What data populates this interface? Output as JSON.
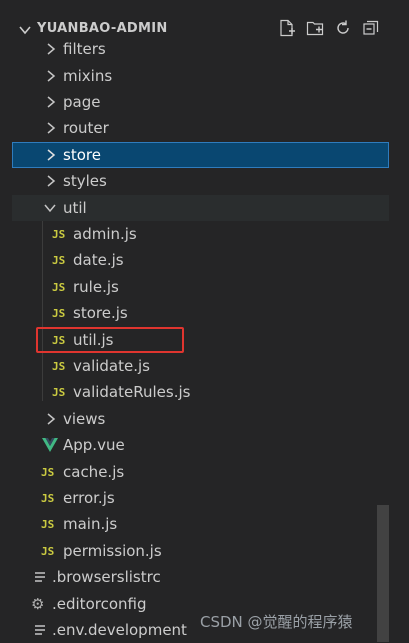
{
  "header": {
    "project_title": "YUANBAO-ADMIN"
  },
  "tree": [
    {
      "label": "filters",
      "type": "folder",
      "expanded": false,
      "icon": "chevron-right-icon"
    },
    {
      "label": "mixins",
      "type": "folder",
      "expanded": false,
      "icon": "chevron-right-icon"
    },
    {
      "label": "page",
      "type": "folder",
      "expanded": false,
      "icon": "chevron-right-icon"
    },
    {
      "label": "router",
      "type": "folder",
      "expanded": false,
      "icon": "chevron-right-icon"
    },
    {
      "label": "store",
      "type": "folder",
      "expanded": false,
      "selected": true,
      "icon": "chevron-right-icon"
    },
    {
      "label": "styles",
      "type": "folder",
      "expanded": false,
      "icon": "chevron-right-icon"
    },
    {
      "label": "util",
      "type": "folder",
      "expanded": true,
      "icon": "chevron-down-icon"
    },
    {
      "label": "admin.js",
      "type": "js",
      "icon_text": "JS"
    },
    {
      "label": "date.js",
      "type": "js",
      "icon_text": "JS"
    },
    {
      "label": "rule.js",
      "type": "js",
      "icon_text": "JS"
    },
    {
      "label": "store.js",
      "type": "js",
      "icon_text": "JS"
    },
    {
      "label": "util.js",
      "type": "js",
      "icon_text": "JS",
      "highlighted": true
    },
    {
      "label": "validate.js",
      "type": "js",
      "icon_text": "JS"
    },
    {
      "label": "validateRules.js",
      "type": "js",
      "icon_text": "JS"
    },
    {
      "label": "views",
      "type": "folder",
      "expanded": false,
      "icon": "chevron-right-icon"
    },
    {
      "label": "App.vue",
      "type": "vue",
      "icon": "vue-icon"
    },
    {
      "label": "cache.js",
      "type": "js",
      "icon_text": "JS"
    },
    {
      "label": "error.js",
      "type": "js",
      "icon_text": "JS"
    },
    {
      "label": "main.js",
      "type": "js",
      "icon_text": "JS"
    },
    {
      "label": "permission.js",
      "type": "js",
      "icon_text": "JS"
    },
    {
      "label": ".browserslistrc",
      "type": "config",
      "icon": "lines-icon"
    },
    {
      "label": ".editorconfig",
      "type": "config",
      "icon": "gear-icon"
    },
    {
      "label": ".env.development",
      "type": "config",
      "icon": "lines-icon"
    }
  ],
  "watermark": "CSDN @觉醒的程序猿",
  "colors": {
    "selected_bg": "#094771",
    "highlight_border": "#e0352f",
    "js_icon": "#cbcb41",
    "vue_icon": "#41b883"
  }
}
